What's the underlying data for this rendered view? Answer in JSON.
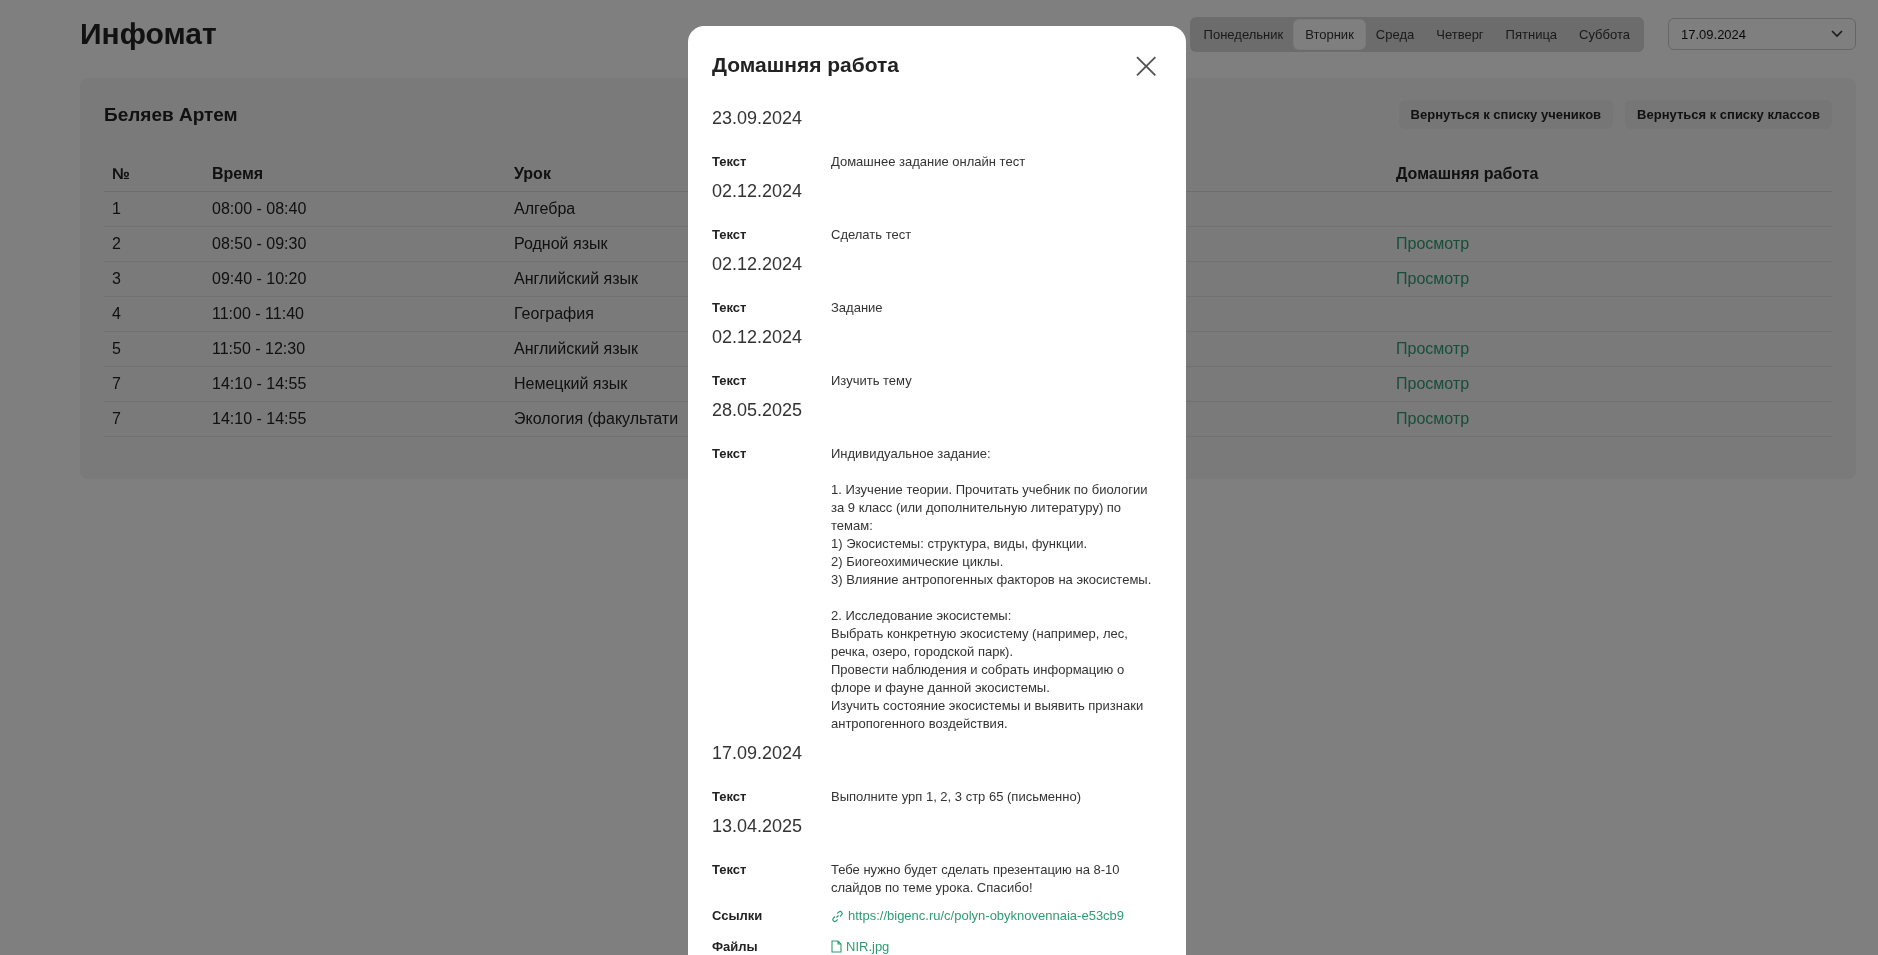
{
  "app_title": "Инфомат",
  "day_tabs": [
    {
      "label": "Понедельник",
      "selected": false
    },
    {
      "label": "Вторник",
      "selected": true
    },
    {
      "label": "Среда",
      "selected": false
    },
    {
      "label": "Четверг",
      "selected": false
    },
    {
      "label": "Пятница",
      "selected": false
    },
    {
      "label": "Суббота",
      "selected": false
    }
  ],
  "date_select": {
    "value": "17.09.2024"
  },
  "student": {
    "name": "Беляев Артем",
    "buttons": [
      "Вернуться к списку учеников",
      "Вернуться к списку классов"
    ]
  },
  "table": {
    "columns": [
      "№",
      "Время",
      "Урок",
      "Домашняя работа"
    ],
    "rows": [
      {
        "number": "1",
        "time": "08:00 - 08:40",
        "lesson": "Алгебра"
      },
      {
        "number": "2",
        "time": "08:50 - 09:30",
        "lesson": "Родной язык",
        "homework": "Просмотр"
      },
      {
        "number": "3",
        "time": "09:40 - 10:20",
        "lesson": "Английский язык",
        "homework": "Просмотр"
      },
      {
        "number": "4",
        "time": "11:00 - 11:40",
        "lesson": "География"
      },
      {
        "number": "5",
        "time": "11:50 - 12:30",
        "lesson": "Английский язык",
        "homework": "Просмотр"
      },
      {
        "number": "7",
        "time": "14:10 - 14:55",
        "lesson": "Немецкий язык",
        "homework": "Просмотр"
      },
      {
        "number": "7",
        "time": "14:10 - 14:55",
        "lesson": "Экология (факультати",
        "homework": "Просмотр"
      }
    ]
  },
  "modal": {
    "title": "Домашняя работа",
    "close": "×",
    "entries": [
      {
        "date": "23.09.2024",
        "fields": [
          {
            "kind": "text",
            "label": "Текст",
            "value": "Домашнее задание онлайн тест"
          }
        ]
      },
      {
        "date": "02.12.2024",
        "fields": [
          {
            "kind": "text",
            "label": "Текст",
            "value": "Сделать тест"
          }
        ]
      },
      {
        "date": "02.12.2024",
        "fields": [
          {
            "kind": "text",
            "label": "Текст",
            "value": "Задание"
          }
        ]
      },
      {
        "date": "02.12.2024",
        "fields": [
          {
            "kind": "text",
            "label": "Текст",
            "value": "Изучить тему"
          }
        ]
      },
      {
        "date": "28.05.2025",
        "fields": [
          {
            "kind": "text",
            "label": "Текст",
            "value": "Индивидуальное задание:\n\n1. Изучение теории. Прочитать учебник по биологии за 9 класс (или дополнительную литературу) по темам:\n1) Экосистемы: структура, виды, функции.\n2) Биогеохимические циклы.\n3) Влияние антропогенных факторов на экосистемы.\n\n2. Исследование экосистемы:\nВыбрать конкретную экосистему (например, лес, речка, озеро, городской парк).\nПровести наблюдения и собрать информацию о флоре и фауне данной экосистемы.\nИзучить состояние экосистемы и выявить признаки антропогенного воздействия."
          }
        ]
      },
      {
        "date": "17.09.2024",
        "fields": [
          {
            "kind": "text",
            "label": "Текст",
            "value": "Выполните урп 1, 2, 3 стр 65 (письменно)"
          }
        ]
      },
      {
        "date": "13.04.2025",
        "fields": [
          {
            "kind": "text",
            "label": "Текст",
            "value": "Тебе нужно будет сделать презентацию на 8-10 слайдов по теме урока. Спасибо!"
          },
          {
            "kind": "link",
            "label": "Ссылки",
            "value": "https://bigenc.ru/c/polyn-obyknovennaia-e53cb9"
          },
          {
            "kind": "file",
            "label": "Файлы",
            "value": "NIR.jpg"
          }
        ]
      }
    ]
  }
}
